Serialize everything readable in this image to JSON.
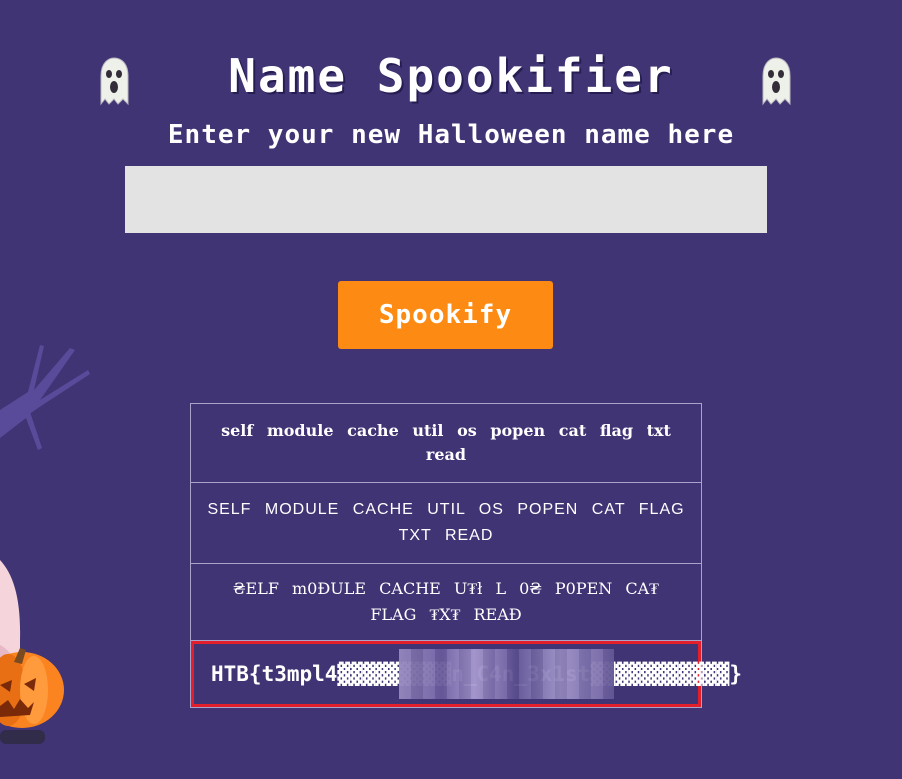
{
  "header": {
    "title": "Name Spookifier",
    "subtitle": "Enter your new Halloween name here",
    "ghost_icon": "ghost-icon"
  },
  "form": {
    "input_value": "",
    "input_placeholder": "",
    "submit_label": "Spookify"
  },
  "results": {
    "rows": [
      {
        "text": "self module cache util os popen cat flag txt read"
      },
      {
        "text": "SELF MODULE CACHE UTIL OS POPEN CAT FLAG TXT READ"
      },
      {
        "text": "₴ELF m0ĐULE CACHE U₮ł L 0₴ P0PEN CA₮ FLAG ₮X₮ REAĐ"
      },
      {
        "text": "HTB{t3mpl4▓▓▓▓▓▓▓▓▓n_C4n_3x1st▓▓▓▓▓▓▓▓▓▓▓}"
      }
    ]
  },
  "colors": {
    "background": "#413474",
    "button": "#fd8a12",
    "input": "#e3e3e4",
    "highlight_border": "#e21f2a"
  }
}
